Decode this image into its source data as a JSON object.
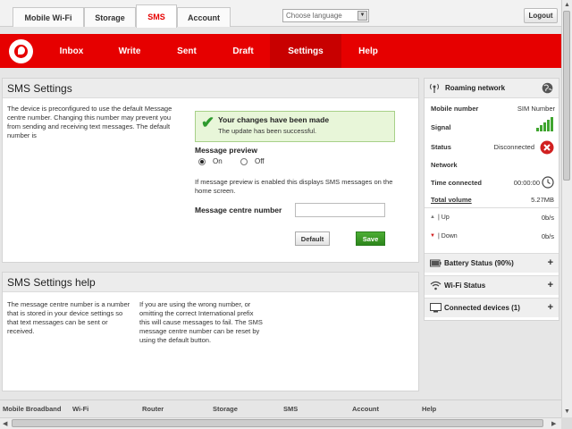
{
  "top_tabs": [
    {
      "label": "Mobile Wi-Fi",
      "active": false
    },
    {
      "label": "Storage",
      "active": false
    },
    {
      "label": "SMS",
      "active": true
    },
    {
      "label": "Account",
      "active": false
    }
  ],
  "language": {
    "placeholder": "Choose language"
  },
  "logout_label": "Logout",
  "nav": {
    "items": [
      "Inbox",
      "Write",
      "Sent",
      "Draft",
      "Settings",
      "Help"
    ],
    "active": "Settings"
  },
  "sms_settings": {
    "title": "SMS Settings",
    "description": "The device is preconfigured to use the default Message centre number. Changing this number may prevent you from sending and receiving text messages. The default number is",
    "success_title": "Your changes have been made",
    "success_text": "The update has been successful.",
    "preview_label": "Message preview",
    "on_label": "On",
    "off_label": "Off",
    "preview_value": "On",
    "preview_note": "If message preview is enabled this displays SMS messages on the home screen.",
    "centre_label": "Message centre number",
    "centre_value": "",
    "default_button": "Default",
    "save_button": "Save"
  },
  "sms_help": {
    "title": "SMS Settings help",
    "col1": "The message centre number is a number that is stored in your device settings so that text messages can be sent or received.",
    "col2": "If you are using the wrong number, or omitting the correct International prefix this will cause messages to fail. The SMS message centre number can be reset by using the default button."
  },
  "sidebar": {
    "network_title": "Roaming network",
    "mobile_number_label": "Mobile number",
    "mobile_number_value": "SIM Number",
    "signal_label": "Signal",
    "signal_bars": 5,
    "status_label": "Status",
    "status_value": "Disconnected",
    "network_label": "Network",
    "time_label": "Time connected",
    "time_value": "00:00:00",
    "volume_label": "Total volume",
    "volume_value": "5.27MB",
    "up_label": "Up",
    "up_value": "0b/s",
    "down_label": "Down",
    "down_value": "0b/s",
    "accordions": [
      {
        "label": "Battery Status (90%)",
        "icon": "battery-icon"
      },
      {
        "label": "Wi-Fi Status",
        "icon": "wifi-icon"
      },
      {
        "label": "Connected devices (1)",
        "icon": "monitor-icon"
      }
    ]
  },
  "footer": [
    "Mobile Broadband",
    "Wi-Fi",
    "Router",
    "Storage",
    "SMS",
    "Account",
    "Help"
  ],
  "colors": {
    "brand": "#e60000",
    "save": "#2d861b",
    "success_bg": "#e8f6d9",
    "error": "#d12020"
  }
}
